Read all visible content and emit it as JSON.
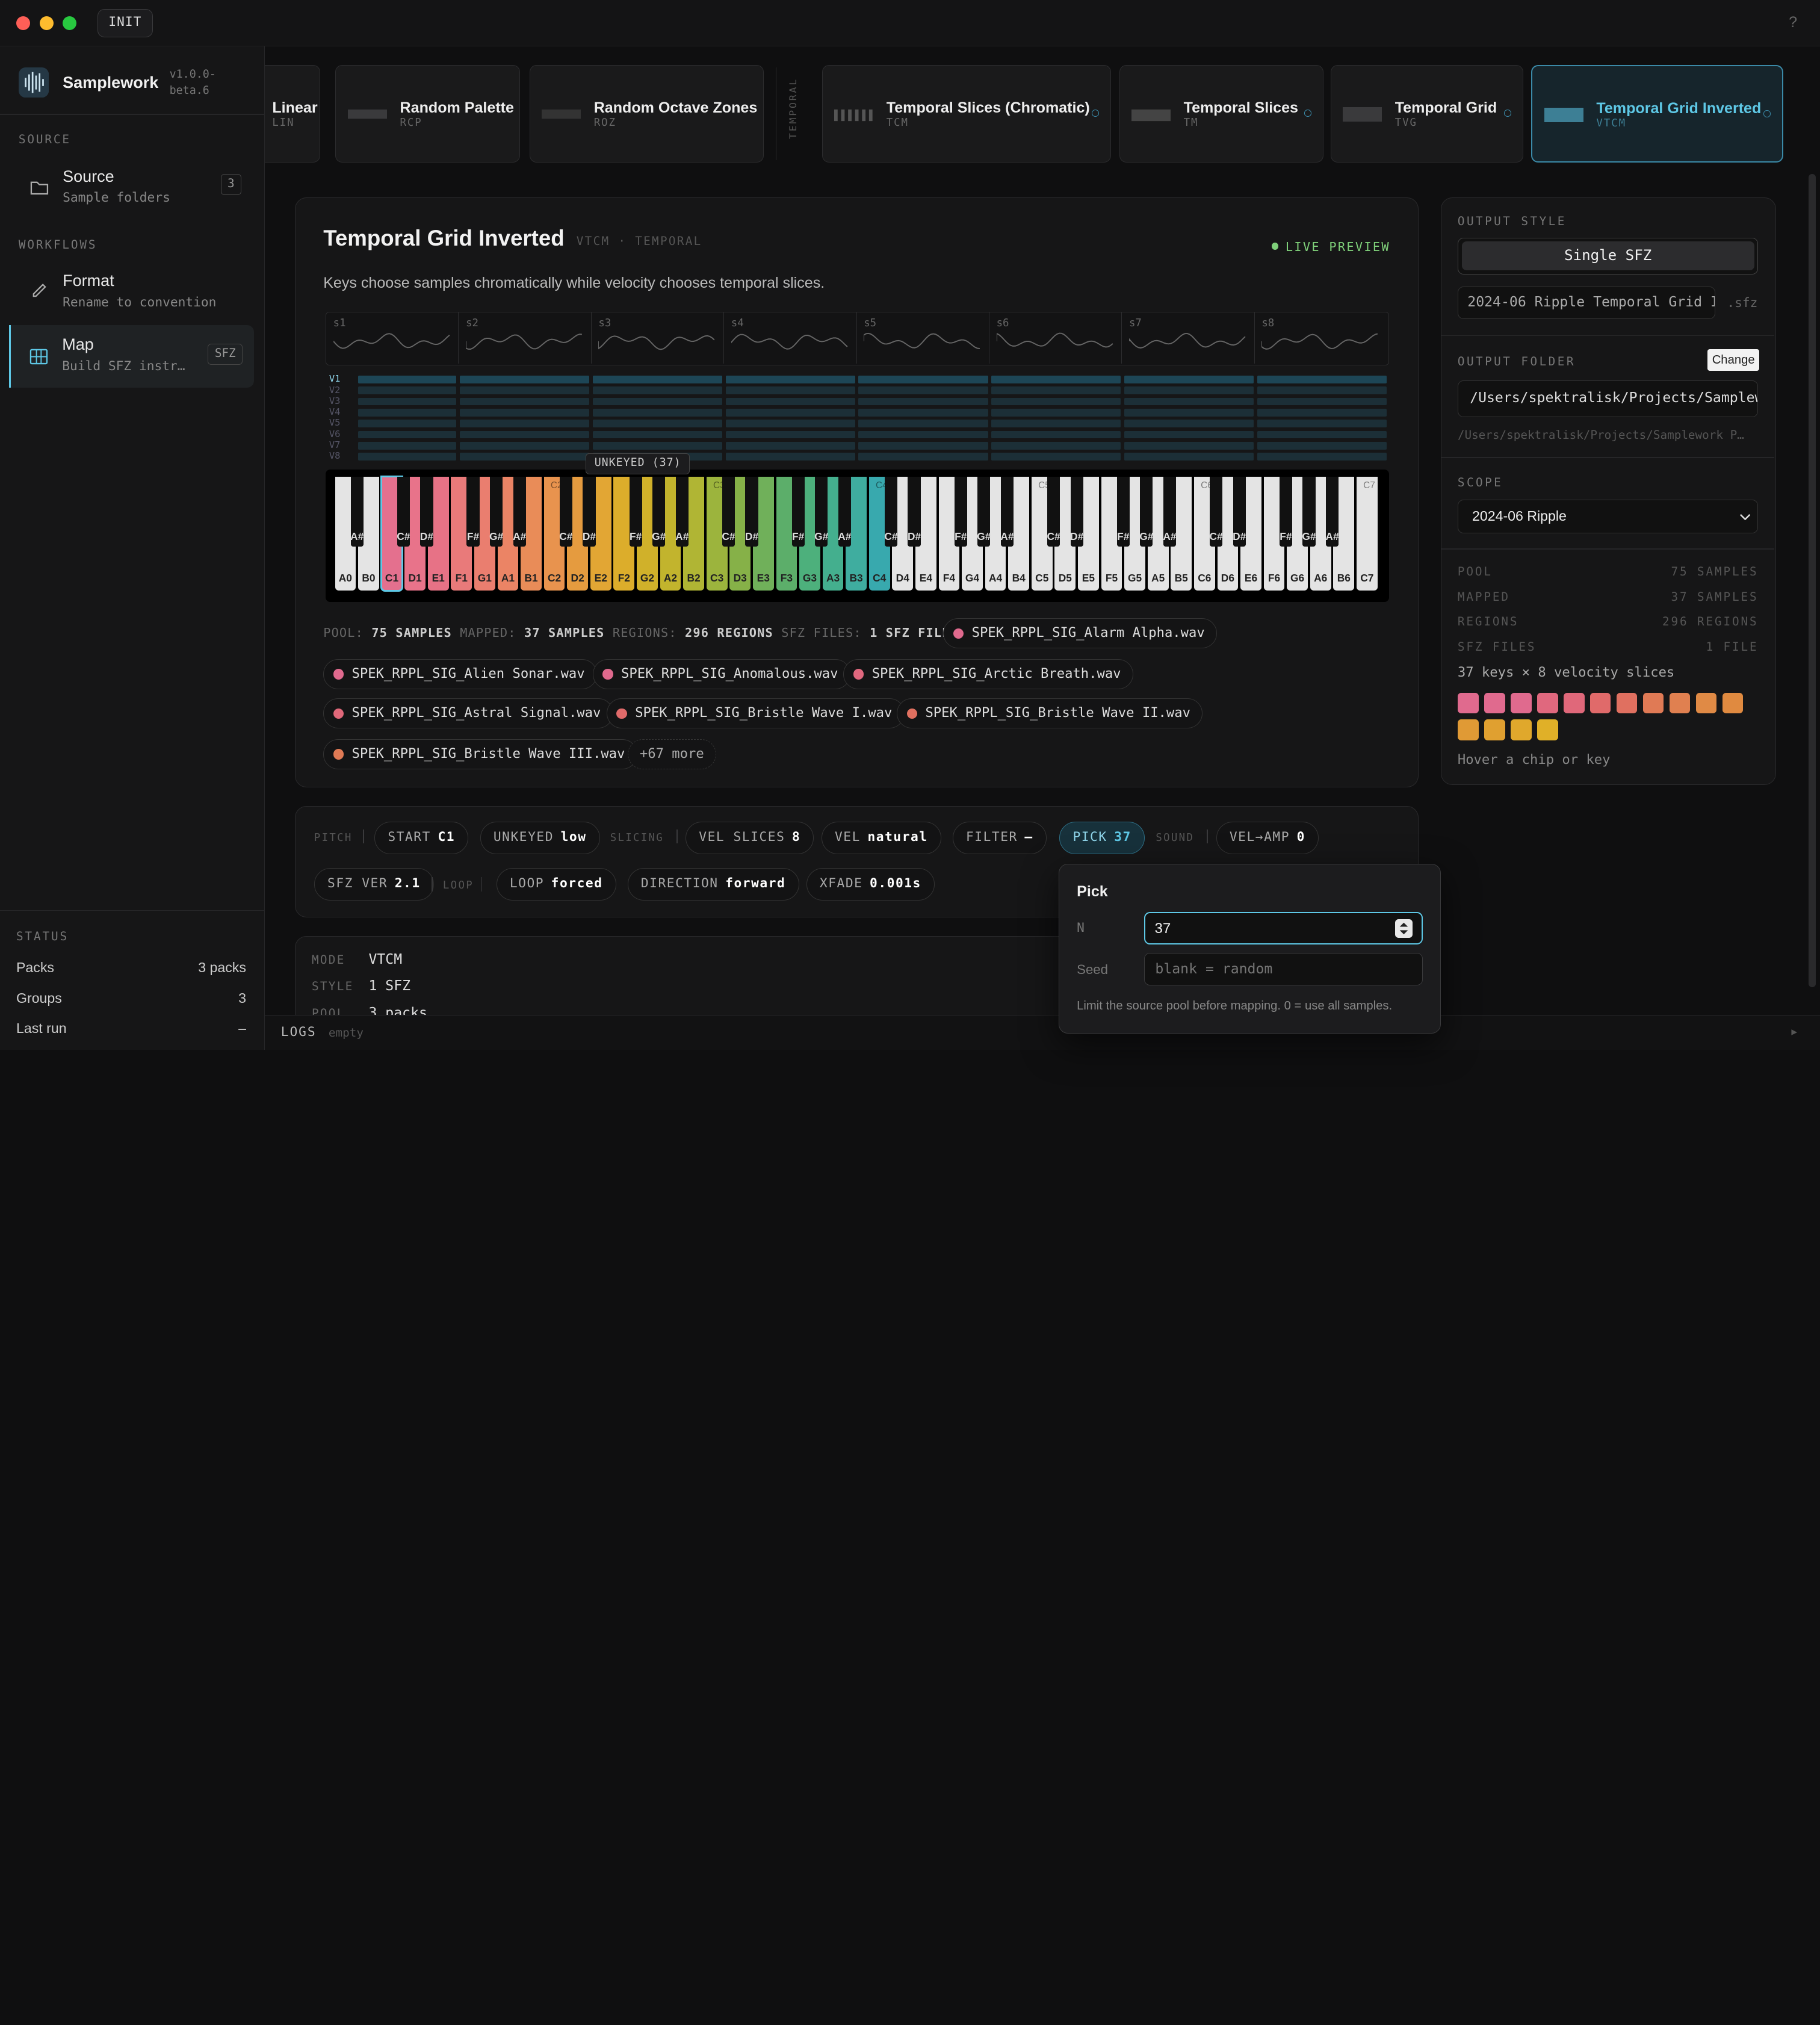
{
  "titlebar": {
    "init_label": "INIT",
    "help_icon": "?"
  },
  "brand": {
    "name": "Samplework",
    "version": "v1.0.0-beta.6"
  },
  "sidebar": {
    "source_heading": "SOURCE",
    "source_item": {
      "title": "Source",
      "subtitle": "Sample folders",
      "badge": "3"
    },
    "workflows_heading": "WORKFLOWS",
    "format_item": {
      "title": "Format",
      "subtitle": "Rename to convention"
    },
    "map_item": {
      "title": "Map",
      "subtitle": "Build SFZ instr…",
      "badge": "SFZ"
    },
    "status_heading": "STATUS",
    "status": [
      {
        "label": "Packs",
        "value": "3 packs"
      },
      {
        "label": "Groups",
        "value": "3"
      },
      {
        "label": "Last run",
        "value": "–"
      }
    ]
  },
  "workflows": [
    {
      "name": "Linear",
      "code": "LIN"
    },
    {
      "name": "Random Palette",
      "code": "RCP"
    },
    {
      "name": "Random Octave Zones",
      "code": "ROZ"
    },
    {
      "name": "Temporal Slices (Chromatic)",
      "code": "TCM"
    },
    {
      "name": "Temporal Slices",
      "code": "TM"
    },
    {
      "name": "Temporal Grid",
      "code": "TVG"
    },
    {
      "name": "Temporal Grid Inverted",
      "code": "VTCM"
    }
  ],
  "temporal_divider": "TEMPORAL",
  "card": {
    "title": "Temporal Grid Inverted",
    "meta": "VTCM · TEMPORAL",
    "live": "LIVE PREVIEW",
    "description": "Keys choose samples chromatically while velocity chooses temporal slices.",
    "slices": [
      "s1",
      "s2",
      "s3",
      "s4",
      "s5",
      "s6",
      "s7",
      "s8"
    ],
    "vel_rows": [
      "V1",
      "V2",
      "V3",
      "V4",
      "V5",
      "V6",
      "V7",
      "V8"
    ],
    "tooltip": "UNKEYED (37)",
    "stats": {
      "pool_label": "POOL:",
      "pool": "75 SAMPLES",
      "mapped_label": "MAPPED:",
      "mapped": "37 SAMPLES",
      "regions_label": "REGIONS:",
      "regions": "296 REGIONS",
      "sfz_label": "SFZ FILES:",
      "sfz": "1 SFZ FILE"
    },
    "chips": [
      "SPEK_RPPL_SIG_Alarm Alpha.wav",
      "SPEK_RPPL_SIG_Alien Sonar.wav",
      "SPEK_RPPL_SIG_Anomalous.wav",
      "SPEK_RPPL_SIG_Arctic Breath.wav",
      "SPEK_RPPL_SIG_Astral Signal.wav",
      "SPEK_RPPL_SIG_Bristle Wave I.wav",
      "SPEK_RPPL_SIG_Bristle Wave II.wav",
      "SPEK_RPPL_SIG_Bristle Wave III.wav"
    ],
    "more": "+67 more"
  },
  "keyboard": {
    "white_keys": [
      "A0",
      "B0",
      "C1",
      "D1",
      "E1",
      "F1",
      "G1",
      "A1",
      "B1",
      "C2",
      "D2",
      "E2",
      "F2",
      "G2",
      "A2",
      "B2",
      "C3",
      "D3",
      "E3",
      "F3",
      "G3",
      "A3",
      "B3",
      "C4",
      "D4",
      "E4",
      "F4",
      "G4",
      "A4",
      "B4",
      "C5",
      "D5",
      "E5",
      "F5",
      "G5",
      "A5",
      "B5",
      "C6",
      "D6",
      "E6",
      "F6",
      "G6",
      "A6",
      "B6",
      "C7"
    ],
    "selected_key": "C1",
    "mapped_from": "C1",
    "mapped_to": "C4",
    "octave_marks": [
      "C2",
      "C3",
      "C4",
      "C5",
      "C6",
      "C7"
    ]
  },
  "params": {
    "groups": {
      "pitch": "PITCH",
      "slicing": "SLICING",
      "sound": "SOUND",
      "loop": "LOOP"
    },
    "pills": [
      {
        "key": "START",
        "val": "C1"
      },
      {
        "key": "UNKEYED",
        "val": "low"
      },
      {
        "key": "VEL SLICES",
        "val": "8"
      },
      {
        "key": "VEL",
        "val": "natural"
      },
      {
        "key": "FILTER",
        "val": "–"
      },
      {
        "key": "PICK",
        "val": "37"
      },
      {
        "key": "VEL→AMP",
        "val": "0"
      },
      {
        "key": "SFZ VER",
        "val": "2.1"
      },
      {
        "key": "LOOP",
        "val": "forced"
      },
      {
        "key": "DIRECTION",
        "val": "forward"
      },
      {
        "key": "XFADE",
        "val": "0.001s"
      }
    ]
  },
  "summary": [
    {
      "label": "MODE",
      "value": "VTCM"
    },
    {
      "label": "STYLE",
      "value": "1 SFZ"
    },
    {
      "label": "POOL",
      "value": "3 packs"
    }
  ],
  "logs": {
    "label": "LOGS",
    "state": "empty"
  },
  "popover": {
    "title": "Pick",
    "n_label": "N",
    "n_value": "37",
    "seed_label": "Seed",
    "seed_placeholder": "blank = random",
    "help": "Limit the source pool before mapping. 0 = use all samples."
  },
  "right_panel": {
    "output_style_heading": "OUTPUT STYLE",
    "output_style": "Single SFZ",
    "filename": "2024-06 Ripple Temporal Grid I",
    "ext": ".sfz",
    "output_folder_heading": "OUTPUT FOLDER",
    "change_label": "Change",
    "folder": "/Users/spektralisk/Projects/Samplew…",
    "folder_hint": "/Users/spektralisk/Projects/Samplework P…",
    "scope_heading": "SCOPE",
    "scope_value": "2024-06 Ripple",
    "stats": [
      {
        "label": "POOL",
        "value": "75 SAMPLES"
      },
      {
        "label": "MAPPED",
        "value": "37 SAMPLES"
      },
      {
        "label": "REGIONS",
        "value": "296 REGIONS"
      },
      {
        "label": "SFZ FILES",
        "value": "1 FILE"
      }
    ],
    "grid_summary": "37 keys × 8 velocity slices",
    "swatches": [
      "#e06a8e",
      "#e06a8e",
      "#e06a8e",
      "#e0687e",
      "#e0687a",
      "#e06a6a",
      "#e07060",
      "#e07a55",
      "#e08050",
      "#e08a45",
      "#e08a40",
      "#e09a35",
      "#e0a030",
      "#e0a82c",
      "#e0b028"
    ],
    "hover_hint": "Hover a chip or key"
  },
  "colors": {
    "accent": "#5ec8e6",
    "live": "#7fd07a"
  }
}
